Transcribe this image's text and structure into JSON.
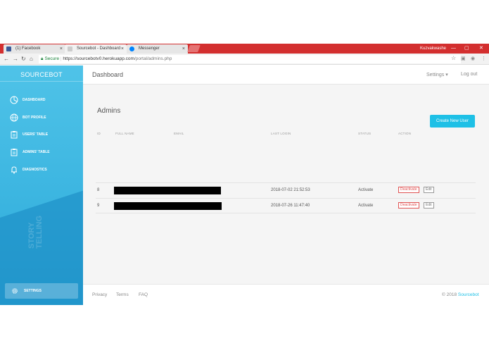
{
  "browser": {
    "tabs": [
      {
        "label": "(1) Facebook",
        "close": "×",
        "color": "#3b5998"
      },
      {
        "label": "Sourcebot - Dashboard",
        "close": "×",
        "color": "#cccccc"
      },
      {
        "label": "Messenger",
        "close": "×",
        "color": "#0084ff"
      }
    ],
    "user": "Kuzvakwashe",
    "address": {
      "secure_label": "Secure",
      "url_host": "https://sourcebotv0.herokuapp.com",
      "url_path": "/portal/admins.php"
    }
  },
  "sidebar": {
    "brand": "SOURCEBOT",
    "items": [
      {
        "label": "DASHBOARD",
        "icon": "pie-chart-icon"
      },
      {
        "label": "BOT PROFILE",
        "icon": "globe-icon"
      },
      {
        "label": "USERS' TABLE",
        "icon": "clipboard-icon"
      },
      {
        "label": "ADMINS' TABLE",
        "icon": "clipboard-icon"
      },
      {
        "label": "DIAGNOSTICS",
        "icon": "bell-icon"
      }
    ],
    "watermark": "STORY TELLING",
    "settings_label": "SETTINGS"
  },
  "header": {
    "title": "Dashboard",
    "settings_menu": "Settings ▾",
    "logout": "Log out"
  },
  "admins": {
    "title": "Admins",
    "create_button": "Create New User",
    "columns": [
      "ID",
      "FULL NAME",
      "EMAIL",
      "LAST LOGIN",
      "STATUS",
      "ACTION"
    ],
    "rows": [
      {
        "id": "8",
        "last_login": "2018-07-02 21:52:53",
        "status": "Activate",
        "deactivate": "Deactivate",
        "edit": "Edit"
      },
      {
        "id": "9",
        "last_login": "2018-07-26 11:47:40",
        "status": "Activate",
        "deactivate": "Deactivate",
        "edit": "Edit"
      }
    ]
  },
  "footer": {
    "links": [
      "Privacy",
      "Terms",
      "FAQ"
    ],
    "copyright_prefix": "© 2018",
    "copyright_brand": "Sourcebot"
  },
  "colors": {
    "accent": "#1ec0e6",
    "sidebar": "#3ab4e0",
    "chrome_bar": "#d32f2f",
    "danger": "#e05252"
  }
}
